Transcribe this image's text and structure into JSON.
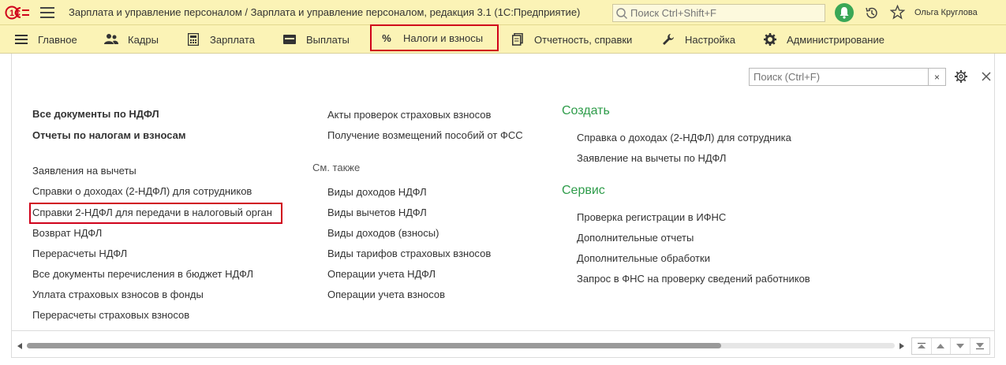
{
  "titlebar": {
    "logo_text": "1С",
    "title": "Зарплата и управление персоналом / Зарплата и управление персоналом, редакция 3.1  (1С:Предприятие)",
    "search_placeholder": "Поиск Ctrl+Shift+F",
    "user_name": "Ольга Круглова",
    "bell_color": "#3aa756"
  },
  "menu": {
    "items": [
      {
        "label": "Главное",
        "icon": "hamburger-icon"
      },
      {
        "label": "Кадры",
        "icon": "people-icon"
      },
      {
        "label": "Зарплата",
        "icon": "calculator-icon"
      },
      {
        "label": "Выплаты",
        "icon": "wallet-icon"
      },
      {
        "label": "Налоги и взносы",
        "icon": "percent-icon",
        "active": true
      },
      {
        "label": "Отчетность, справки",
        "icon": "documents-icon"
      },
      {
        "label": "Настройка",
        "icon": "wrench-icon"
      },
      {
        "label": "Администрирование",
        "icon": "gear-icon"
      }
    ],
    "percent_glyph": "%",
    "active_border_color": "#d0021b"
  },
  "panel": {
    "search_placeholder": "Поиск (Ctrl+F)",
    "clear_glyph": "×",
    "column1": {
      "bold_links": [
        "Все документы по НДФЛ",
        "Отчеты по налогам и взносам"
      ],
      "links": [
        "Заявления на вычеты",
        "Справки о доходах (2-НДФЛ) для сотрудников",
        "Справки 2-НДФЛ для передачи в налоговый орган",
        "Возврат НДФЛ",
        "Перерасчеты НДФЛ",
        "Все документы перечисления в бюджет НДФЛ",
        "Уплата страховых взносов в фонды",
        "Перерасчеты страховых взносов"
      ]
    },
    "column2": {
      "links": [
        "Акты проверок страховых взносов",
        "Получение возмещений пособий от ФСС"
      ],
      "see_also_label": "См. также",
      "see_also": [
        "Виды доходов НДФЛ",
        "Виды вычетов НДФЛ",
        "Виды доходов (взносы)",
        "Виды тарифов страховых взносов",
        "Операции учета НДФЛ",
        "Операции учета взносов"
      ]
    },
    "column3": {
      "create_heading": "Создать",
      "create_links": [
        "Справка о доходах (2-НДФЛ) для сотрудника",
        "Заявление на вычеты по НДФЛ"
      ],
      "service_heading": "Сервис",
      "service_links": [
        "Проверка регистрации в ИФНС",
        "Дополнительные отчеты",
        "Дополнительные обработки",
        "Запрос в ФНС на проверку сведений работников"
      ],
      "heading_color": "#2e9c4a"
    }
  },
  "scrollbar": {
    "position_fraction": 0.8
  }
}
